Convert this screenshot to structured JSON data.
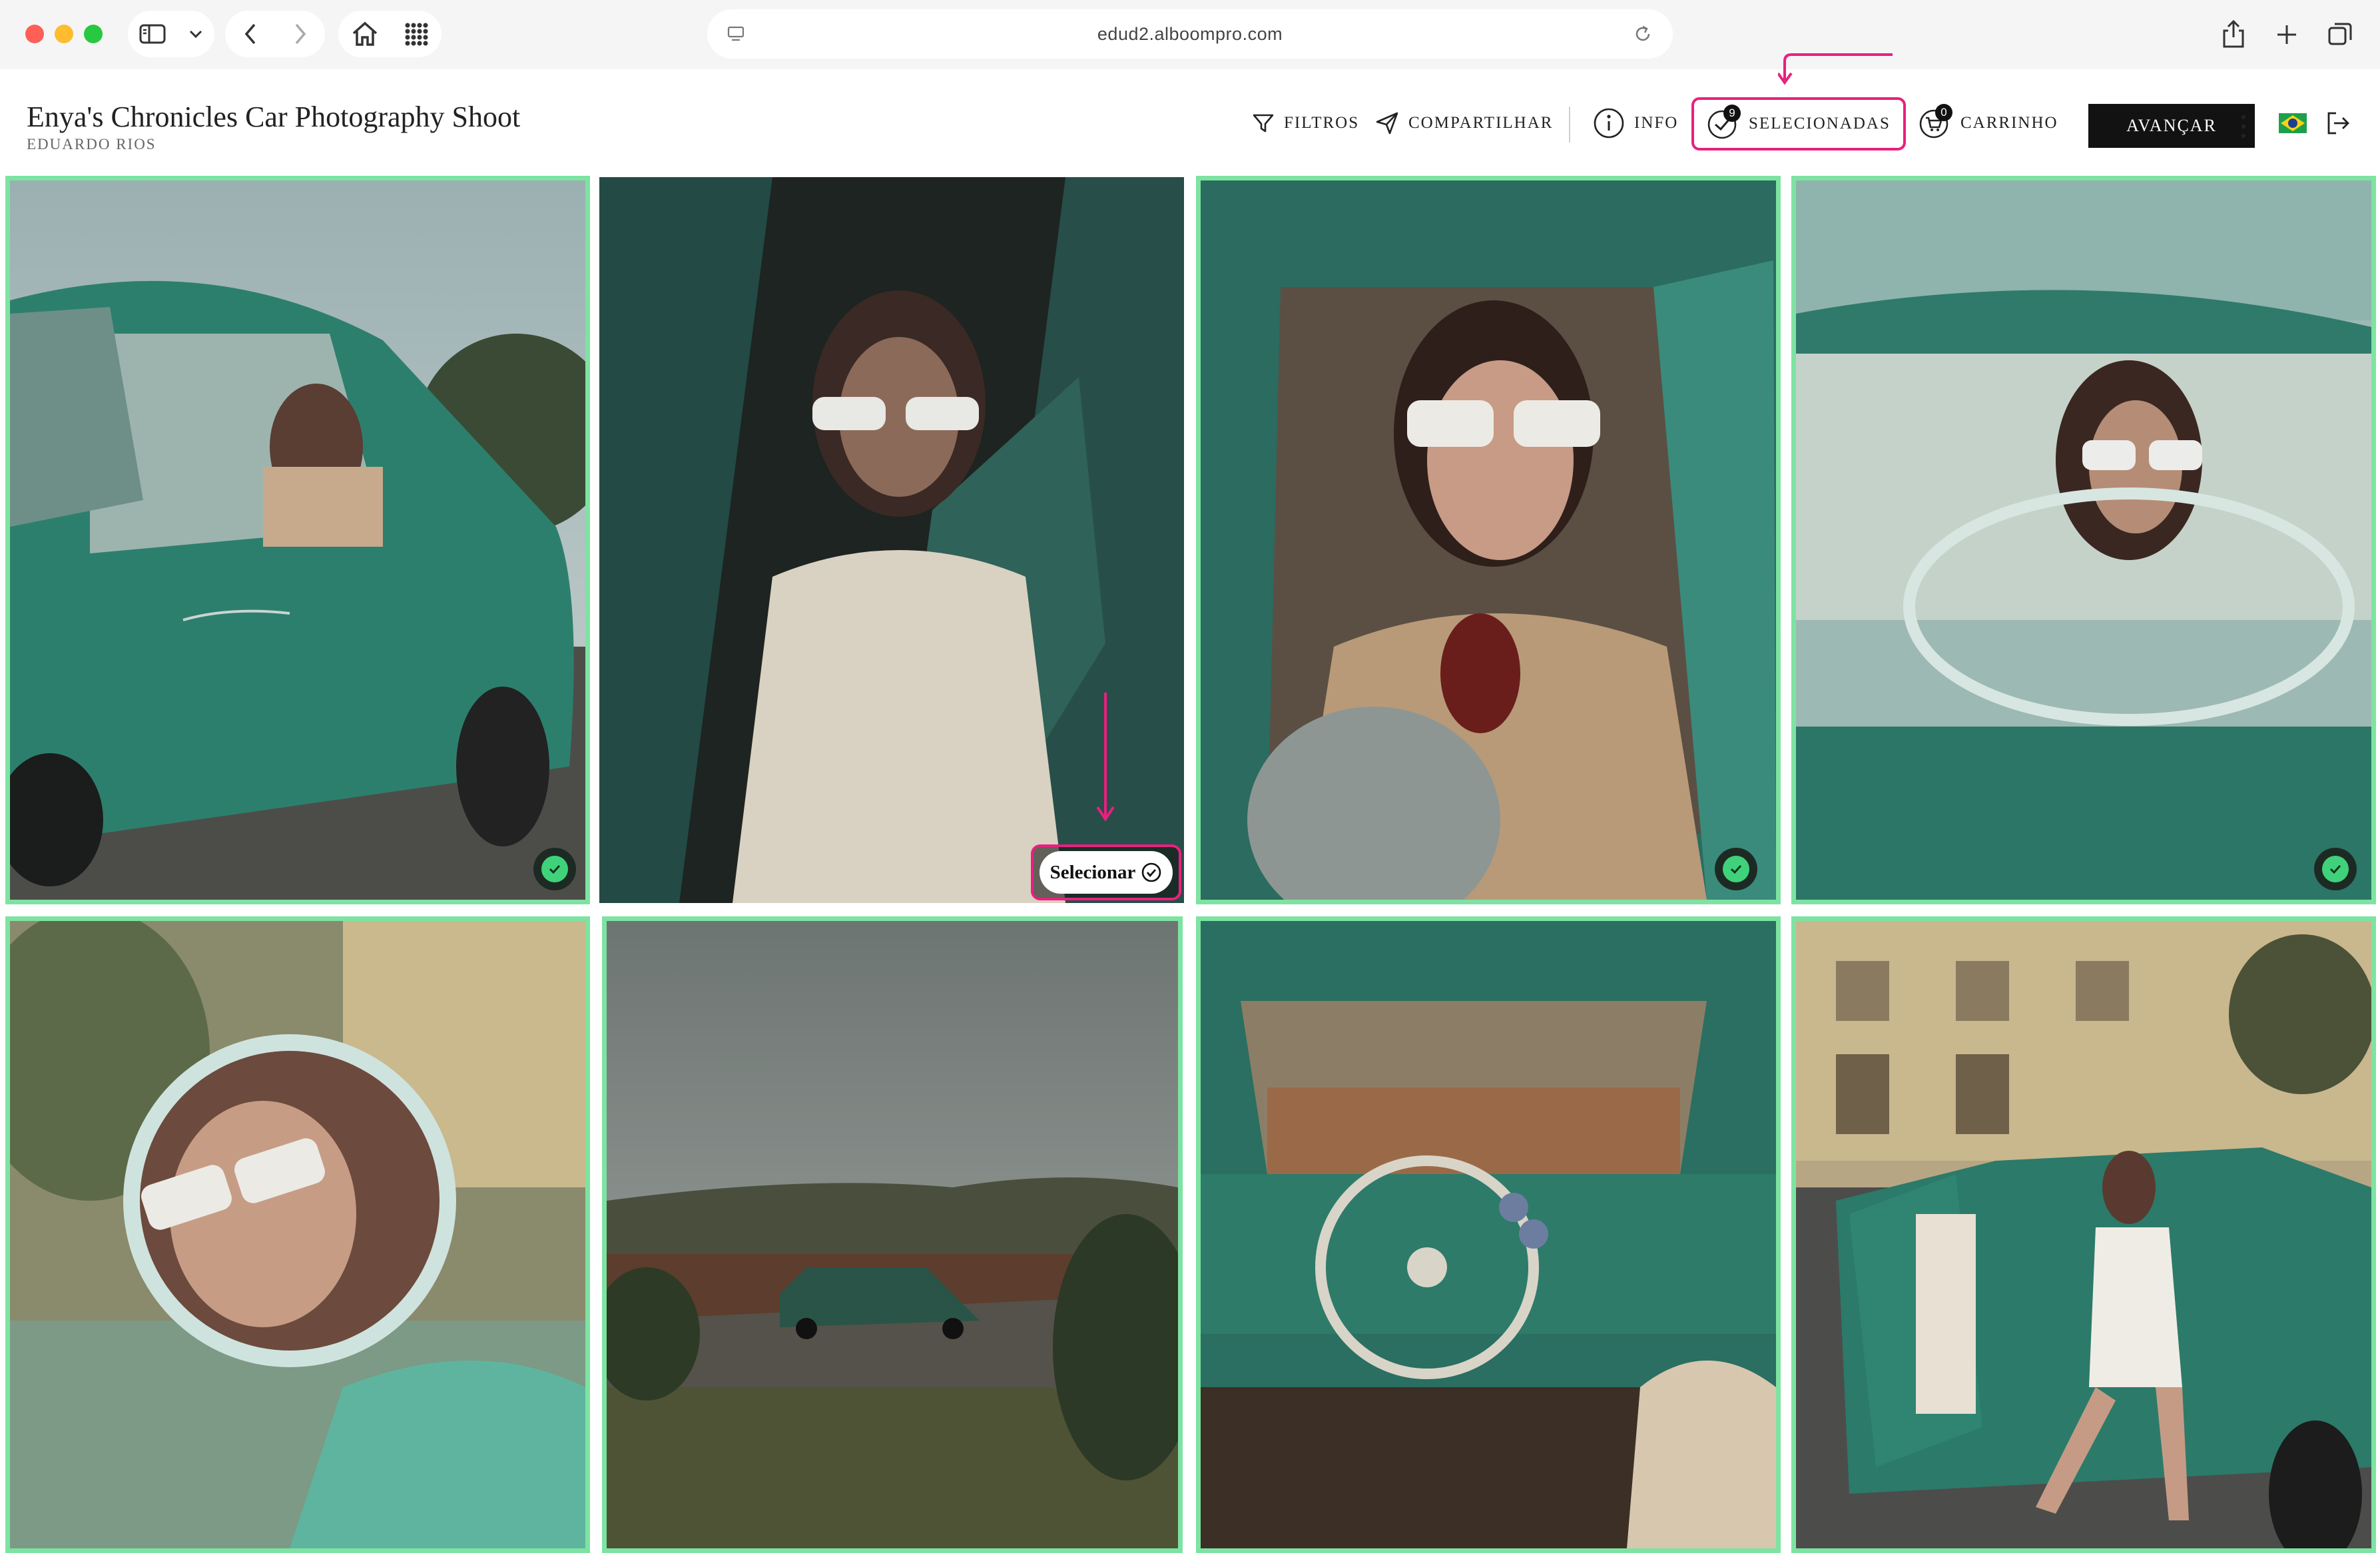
{
  "browser": {
    "url": "edud2.alboompro.com"
  },
  "header": {
    "title": "Enya's Chronicles Car Photography Shoot",
    "photographer": "EDUARDO RIOS"
  },
  "toolbar": {
    "filters_label": "FILTROS",
    "share_label": "COMPARTILHAR",
    "info_label": "INFO",
    "selected_label": "SELECIONADAS",
    "selected_count": "9",
    "cart_label": "CARRINHO",
    "cart_count": "0",
    "advance_label": "AVANÇAR"
  },
  "photos": [
    {
      "id": 1,
      "selected": true,
      "icon": "check-icon"
    },
    {
      "id": 2,
      "selected": false,
      "select_label": "Selecionar"
    },
    {
      "id": 3,
      "selected": true,
      "icon": "check-icon"
    },
    {
      "id": 4,
      "selected": true,
      "icon": "check-icon"
    },
    {
      "id": 5,
      "selected": true
    },
    {
      "id": 6,
      "selected": true
    },
    {
      "id": 7,
      "selected": true
    },
    {
      "id": 8,
      "selected": true
    }
  ],
  "colors": {
    "selection_border": "#7ee3a2",
    "highlight": "#e9207e",
    "advance_button": "#121212"
  }
}
